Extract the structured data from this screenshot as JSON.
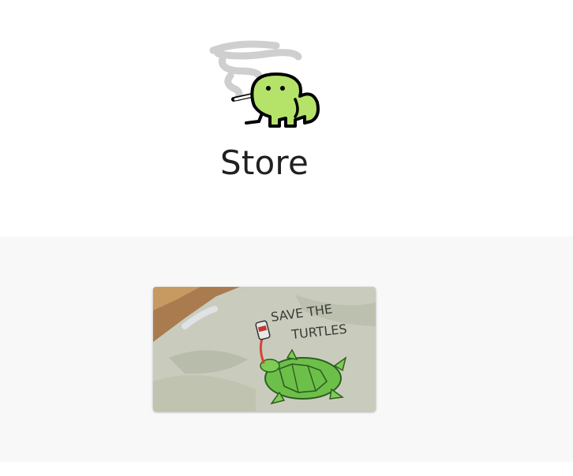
{
  "header": {
    "logo_icon": "smoking-frog-icon",
    "title": "Store"
  },
  "products": [
    {
      "image_icon": "save-the-turtles-shirt-photo",
      "shirt_text_line1": "SAVE THE",
      "shirt_text_line2": "TURTLES"
    }
  ],
  "colors": {
    "page_background": "#ffffff",
    "section_background": "#f8f8f8",
    "title_text": "#212121",
    "frog_green": "#b5e36a",
    "turtle_green": "#6cc04a",
    "shirt": "#c8cbb9"
  }
}
